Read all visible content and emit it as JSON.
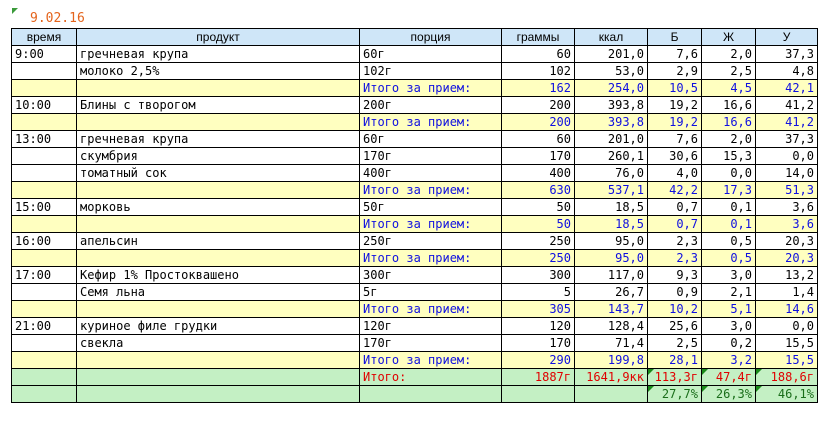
{
  "date": "9.02.16",
  "headers": [
    "время",
    "продукт",
    "порция",
    "граммы",
    "ккал",
    "Б",
    "Ж",
    "У"
  ],
  "rows": [
    {
      "type": "item",
      "cells": [
        "9:00",
        "гречневая крупа",
        "60г",
        "60",
        "201,0",
        "7,6",
        "2,0",
        "37,3"
      ]
    },
    {
      "type": "item",
      "cells": [
        "",
        "молоко 2,5%",
        "102г",
        "102",
        "53,0",
        "2,9",
        "2,5",
        "4,8"
      ]
    },
    {
      "type": "subtotal",
      "cells": [
        "",
        "",
        "Итого за прием:",
        "162",
        "254,0",
        "10,5",
        "4,5",
        "42,1"
      ]
    },
    {
      "type": "item",
      "cells": [
        "10:00",
        "Блины с творогом",
        "200г",
        "200",
        "393,8",
        "19,2",
        "16,6",
        "41,2"
      ]
    },
    {
      "type": "subtotal",
      "cells": [
        "",
        "",
        "Итого за прием:",
        "200",
        "393,8",
        "19,2",
        "16,6",
        "41,2"
      ]
    },
    {
      "type": "item",
      "cells": [
        "13:00",
        "гречневая крупа",
        "60г",
        "60",
        "201,0",
        "7,6",
        "2,0",
        "37,3"
      ]
    },
    {
      "type": "item",
      "cells": [
        "",
        "скумбрия",
        "170г",
        "170",
        "260,1",
        "30,6",
        "15,3",
        "0,0"
      ]
    },
    {
      "type": "item",
      "cells": [
        "",
        "томатный сок",
        "400г",
        "400",
        "76,0",
        "4,0",
        "0,0",
        "14,0"
      ]
    },
    {
      "type": "subtotal",
      "cells": [
        "",
        "",
        "Итого за прием:",
        "630",
        "537,1",
        "42,2",
        "17,3",
        "51,3"
      ]
    },
    {
      "type": "item",
      "cells": [
        "15:00",
        "морковь",
        "50г",
        "50",
        "18,5",
        "0,7",
        "0,1",
        "3,6"
      ]
    },
    {
      "type": "subtotal",
      "cells": [
        "",
        "",
        "Итого за прием:",
        "50",
        "18,5",
        "0,7",
        "0,1",
        "3,6"
      ]
    },
    {
      "type": "item",
      "cells": [
        "16:00",
        "апельсин",
        "250г",
        "250",
        "95,0",
        "2,3",
        "0,5",
        "20,3"
      ]
    },
    {
      "type": "subtotal",
      "cells": [
        "",
        "",
        "Итого за прием:",
        "250",
        "95,0",
        "2,3",
        "0,5",
        "20,3"
      ]
    },
    {
      "type": "item",
      "cells": [
        "17:00",
        "Кефир 1% Простоквашено",
        "300г",
        "300",
        "117,0",
        "9,3",
        "3,0",
        "13,2"
      ]
    },
    {
      "type": "item",
      "cells": [
        "",
        "Семя льна",
        "5г",
        "5",
        "26,7",
        "0,9",
        "2,1",
        "1,4"
      ]
    },
    {
      "type": "subtotal",
      "cells": [
        "",
        "",
        "Итого за прием:",
        "305",
        "143,7",
        "10,2",
        "5,1",
        "14,6"
      ]
    },
    {
      "type": "item",
      "cells": [
        "21:00",
        "куриное филе грудки",
        "120г",
        "120",
        "128,4",
        "25,6",
        "3,0",
        "0,0"
      ]
    },
    {
      "type": "item",
      "cells": [
        "",
        "свекла",
        "170г",
        "170",
        "71,4",
        "2,5",
        "0,2",
        "15,5"
      ]
    },
    {
      "type": "subtotal",
      "cells": [
        "",
        "",
        "Итого за прием:",
        "290",
        "199,8",
        "28,1",
        "3,2",
        "15,5"
      ]
    },
    {
      "type": "grand",
      "cells": [
        "",
        "",
        "Итого:",
        "1887г",
        "1641,9кк",
        "113,3г",
        "47,4г",
        "188,6г"
      ]
    },
    {
      "type": "pct",
      "cells": [
        "",
        "",
        "",
        "",
        "",
        "27,7%",
        "26,3%",
        "46,1%"
      ]
    }
  ],
  "colors": {
    "header": "#cfe6f8",
    "subtotal": "#ffffc0",
    "total": "#c4f0c4",
    "date": "#e4641c"
  }
}
